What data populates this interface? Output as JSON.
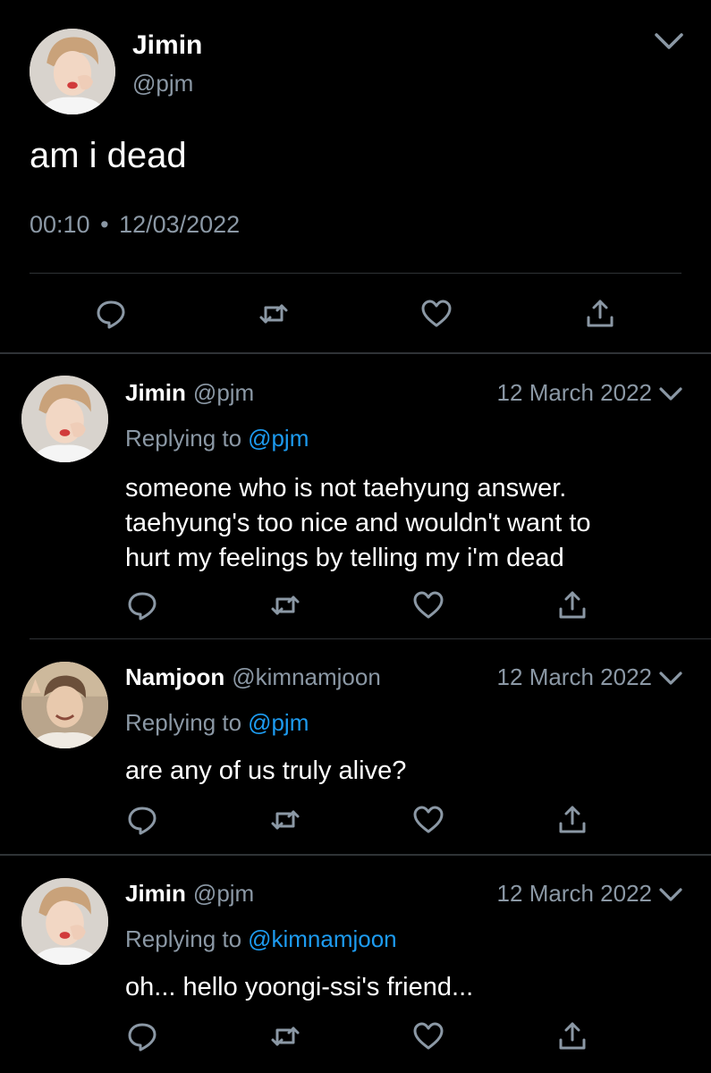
{
  "main_tweet": {
    "name": "Jimin",
    "handle": "@pjm",
    "text": "am i dead",
    "time": "00:10",
    "separator": "•",
    "date": "12/03/2022",
    "avatar_icon": "avatar-jimin"
  },
  "replies": [
    {
      "name": "Jimin",
      "handle": "@pjm",
      "date": "12 March 2022",
      "replying_label": "Replying to",
      "replying_to": "@pjm",
      "text_lines": [
        "someone who is not taehyung answer.",
        "taehyung's too nice and wouldn't want to",
        "hurt my feelings by telling my i'm dead"
      ],
      "avatar_icon": "avatar-jimin"
    },
    {
      "name": "Namjoon",
      "handle": "@kimnamjoon",
      "date": "12 March 2022",
      "replying_label": "Replying to",
      "replying_to": "@pjm",
      "text_lines": [
        "are any of us truly alive?"
      ],
      "avatar_icon": "avatar-namjoon"
    },
    {
      "name": "Jimin",
      "handle": "@pjm",
      "date": "12 March 2022",
      "replying_label": "Replying to",
      "replying_to": "@kimnamjoon",
      "text_lines": [
        "oh... hello yoongi-ssi's friend..."
      ],
      "avatar_icon": "avatar-jimin"
    }
  ],
  "action_icons": [
    "reply-icon",
    "retweet-icon",
    "like-icon",
    "share-icon"
  ],
  "colors": {
    "background": "#000000",
    "text": "#ffffff",
    "secondary": "#8b98a5",
    "mention": "#1d9bf0",
    "divider": "#2f3336"
  }
}
